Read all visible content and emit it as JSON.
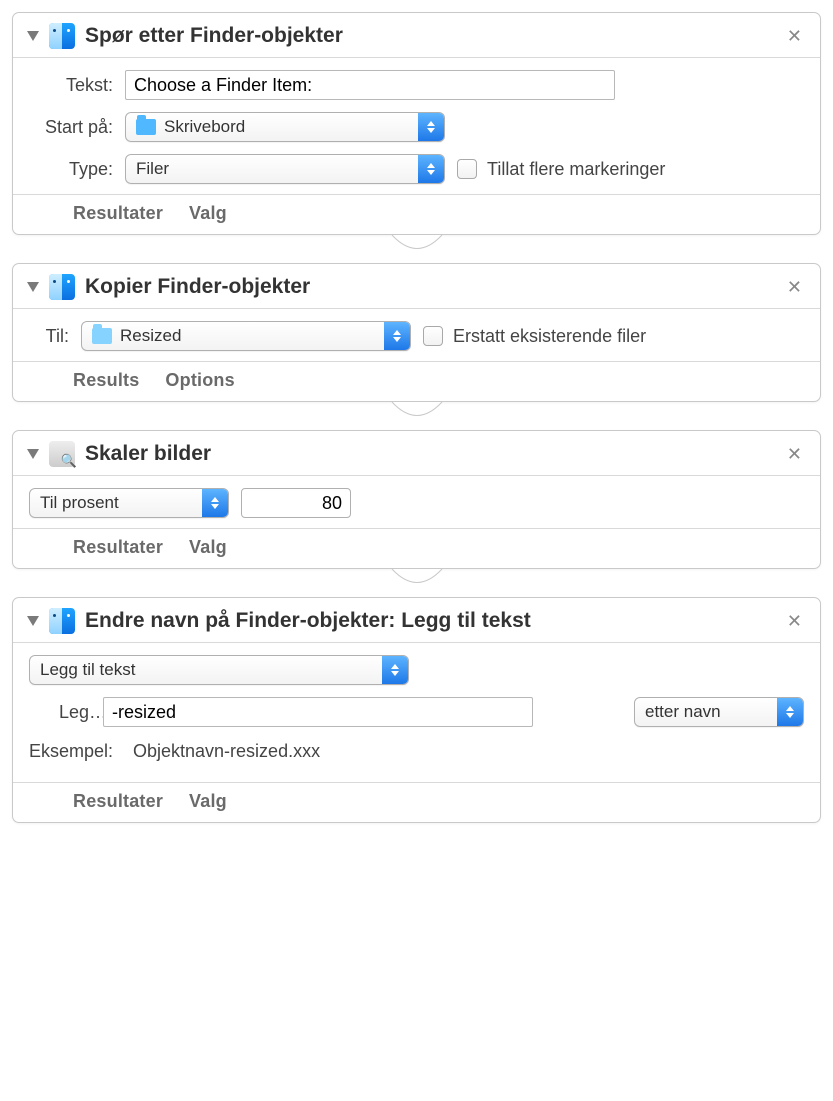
{
  "actions": {
    "ask": {
      "title": "Spør etter Finder-objekter",
      "text_label": "Tekst:",
      "text_value": "Choose a Finder Item:",
      "start_label": "Start på:",
      "start_value": "Skrivebord",
      "type_label": "Type:",
      "type_value": "Filer",
      "allow_multi_label": "Tillat flere markeringer",
      "footer_results": "Resultater",
      "footer_options": "Valg"
    },
    "copy": {
      "title": "Kopier Finder-objekter",
      "to_label": "Til:",
      "to_value": "Resized",
      "replace_label": "Erstatt eksisterende filer",
      "footer_results": "Results",
      "footer_options": "Options"
    },
    "scale": {
      "title": "Skaler bilder",
      "mode_value": "Til prosent",
      "amount_value": "80",
      "footer_results": "Resultater",
      "footer_options": "Valg"
    },
    "rename": {
      "title": "Endre navn på Finder-objekter: Legg til tekst",
      "mode_value": "Legg til tekst",
      "add_label": "Leg…",
      "add_value": "-resized",
      "position_value": "etter navn",
      "example_label": "Eksempel:",
      "example_value": "Objektnavn-resized.xxx",
      "footer_results": "Resultater",
      "footer_options": "Valg"
    }
  }
}
